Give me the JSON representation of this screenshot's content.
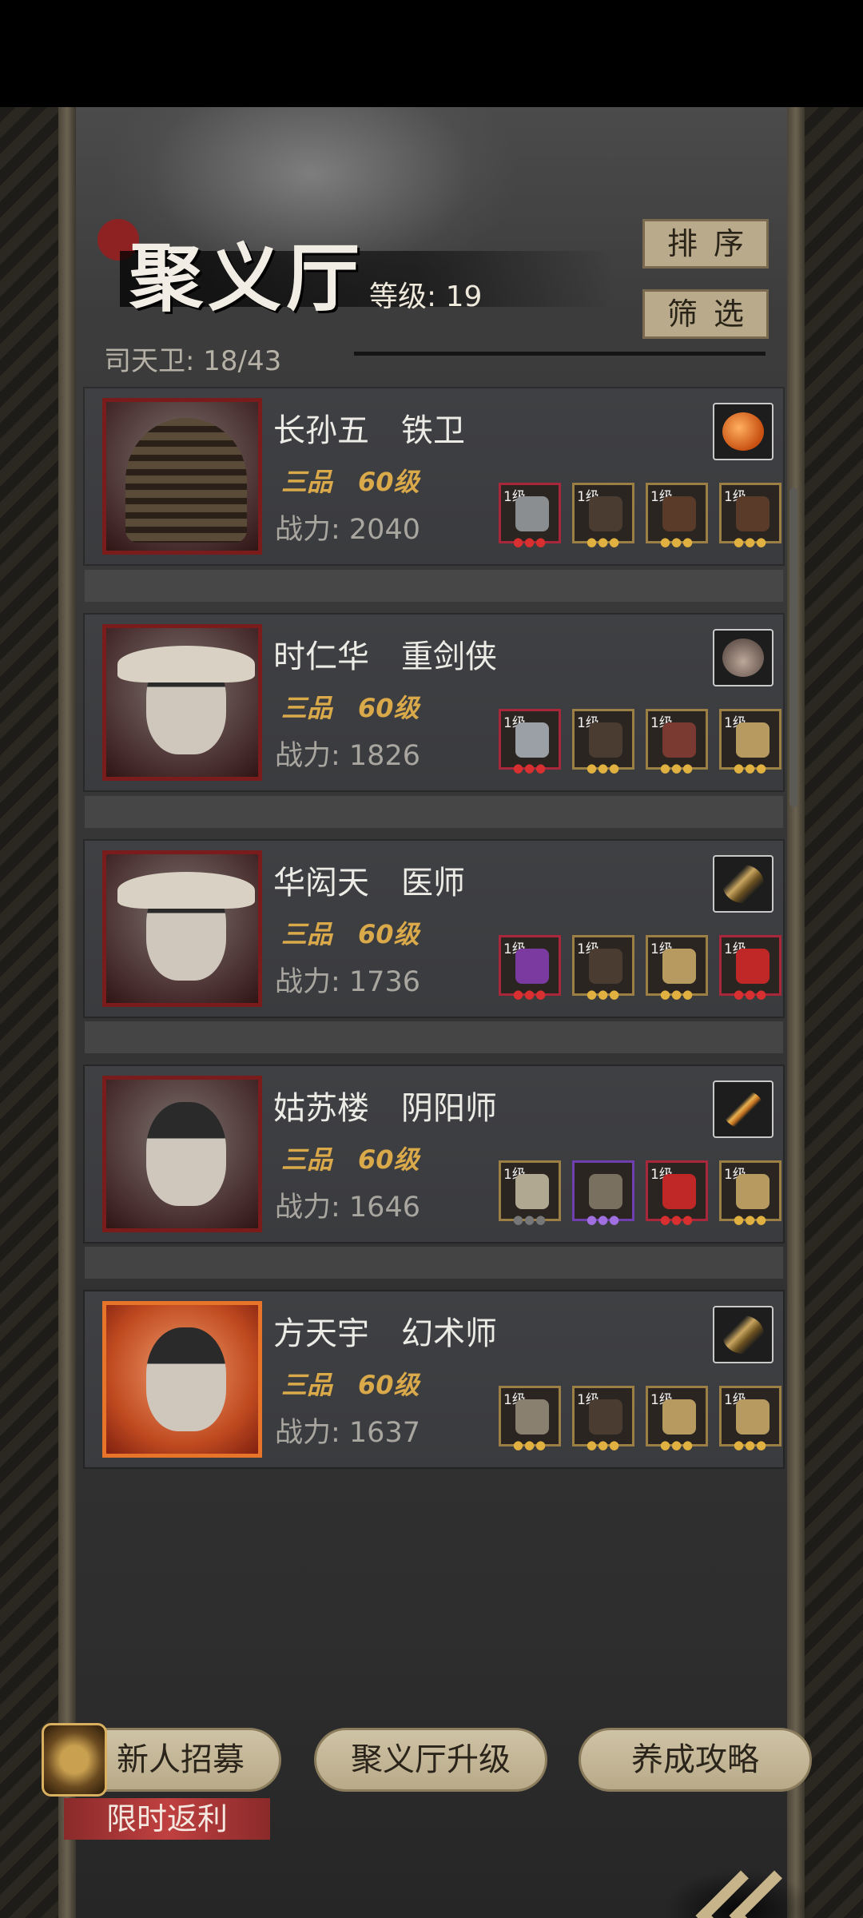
{
  "hall": {
    "title": "聚义厅",
    "level_label": "等级: 19",
    "guard_count": "司天卫: 18/43",
    "sort_label": "排序",
    "filter_label": "筛选"
  },
  "heroes": [
    {
      "name": "长孙五　铁卫",
      "rank": "三品　60级",
      "power": "战力: 2040",
      "treasure_icon": "amber-gem-icon",
      "slots": [
        {
          "lv": "1级",
          "icon": "hammer-icon",
          "quality": "red"
        },
        {
          "lv": "1级",
          "icon": "armor-icon",
          "quality": "gold"
        },
        {
          "lv": "1级",
          "icon": "boots-icon",
          "quality": "gold"
        },
        {
          "lv": "1级",
          "icon": "boots-icon",
          "quality": "gold"
        }
      ]
    },
    {
      "name": "时仁华　重剑侠",
      "rank": "三品　60级",
      "power": "战力: 1826",
      "treasure_icon": "rabbit-icon",
      "slots": [
        {
          "lv": "1级",
          "icon": "sword-icon",
          "quality": "red"
        },
        {
          "lv": "1级",
          "icon": "armor-icon",
          "quality": "gold"
        },
        {
          "lv": "1级",
          "icon": "mask-icon",
          "quality": "gold"
        },
        {
          "lv": "1级",
          "icon": "pouch-icon",
          "quality": "gold"
        }
      ]
    },
    {
      "name": "华闳天　医师",
      "rank": "三品　60级",
      "power": "战力: 1736",
      "treasure_icon": "feather-icon",
      "slots": [
        {
          "lv": "1级",
          "icon": "gourd-icon",
          "quality": "red"
        },
        {
          "lv": "1级",
          "icon": "armor-icon",
          "quality": "gold"
        },
        {
          "lv": "1级",
          "icon": "pouch-icon",
          "quality": "gold"
        },
        {
          "lv": "1级",
          "icon": "glove-icon",
          "quality": "red"
        }
      ]
    },
    {
      "name": "姑苏楼　阴阳师",
      "rank": "三品　60级",
      "power": "战力: 1646",
      "treasure_icon": "wand-icon",
      "slots": [
        {
          "lv": "1级",
          "icon": "staff-icon",
          "quality": "grey"
        },
        {
          "lv": "",
          "icon": "robe-icon",
          "quality": "purple"
        },
        {
          "lv": "1级",
          "icon": "glove-icon",
          "quality": "red"
        },
        {
          "lv": "1级",
          "icon": "pouch-icon",
          "quality": "gold"
        }
      ]
    },
    {
      "name": "方天宇　幻术师",
      "rank": "三品　60级",
      "power": "战力: 1637",
      "treasure_icon": "feather-icon",
      "slots": [
        {
          "lv": "1级",
          "icon": "scythe-icon",
          "quality": "gold"
        },
        {
          "lv": "1级",
          "icon": "armor-icon",
          "quality": "gold"
        },
        {
          "lv": "1级",
          "icon": "pouch-icon",
          "quality": "gold"
        },
        {
          "lv": "1级",
          "icon": "pouch-icon",
          "quality": "gold"
        }
      ]
    }
  ],
  "bottom": {
    "recruit_label": "新人招募",
    "upgrade_label": "聚义厅升级",
    "guide_label": "养成攻略",
    "promo_label": "限时返利"
  },
  "colors": {
    "accent_gold": "#d9a94a",
    "button_bg": "#b9aa8b",
    "quality_red": "#a8273a",
    "quality_gold": "#9c7f44",
    "quality_purple": "#6f3fb0"
  }
}
